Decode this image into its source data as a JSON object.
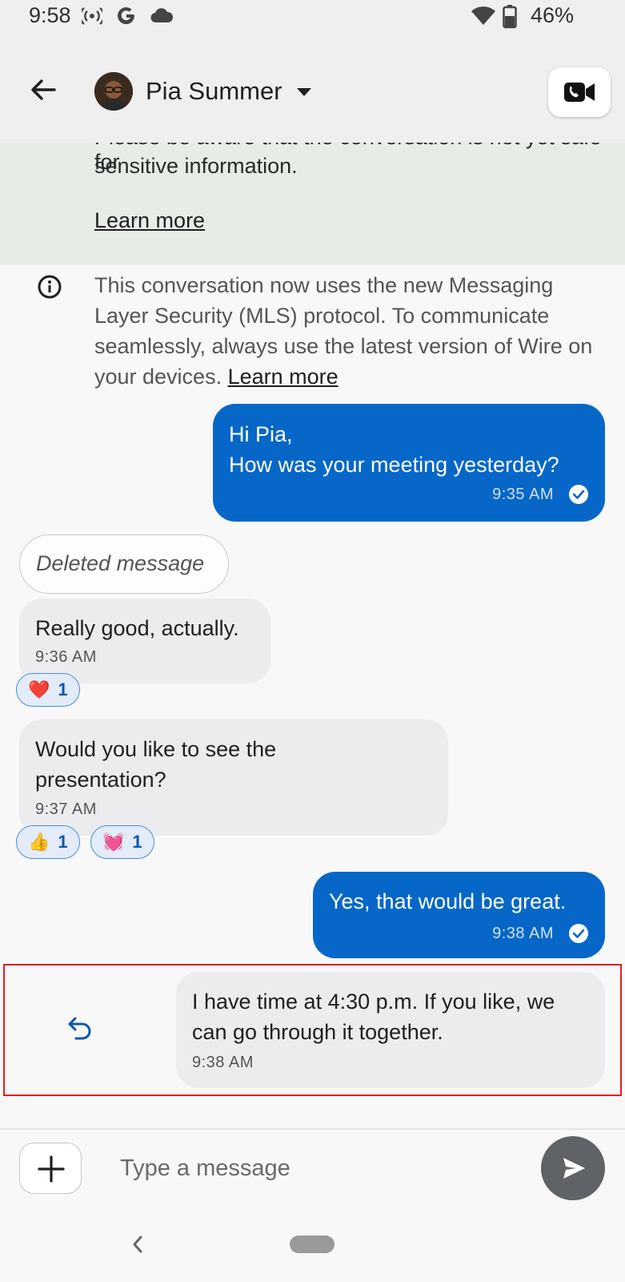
{
  "status_bar": {
    "time": "9:58",
    "battery": "46%",
    "icons": [
      "broadcast-icon",
      "google-icon",
      "cloud-icon",
      "wifi-icon",
      "battery-icon"
    ]
  },
  "header": {
    "contact_name": "Pia Summer",
    "icons": [
      "back-arrow-icon",
      "avatar",
      "caret-down-icon",
      "video-call-icon"
    ]
  },
  "notice": {
    "partial_line": "Please be aware that the conversation is not yet safe for",
    "text": "sensitive information.",
    "link": "Learn more"
  },
  "system_message": {
    "text": "This conversation now uses the new Messaging Layer Security (MLS) protocol. To communicate seamlessly, always use the latest version of Wire on your devices. ",
    "link": "Learn more"
  },
  "messages": [
    {
      "direction": "out",
      "text": "Hi Pia,\nHow was your meeting yesterday?",
      "time": "9:35 AM",
      "status": "delivered"
    },
    {
      "direction": "in",
      "deleted": true,
      "text": "Deleted message"
    },
    {
      "direction": "in",
      "text": "Really good, actually.",
      "time": "9:36 AM",
      "reactions": [
        {
          "emoji": "❤️",
          "count": "1"
        }
      ]
    },
    {
      "direction": "in",
      "text": "Would you like to see the\npresentation?",
      "time": "9:37 AM",
      "reactions": [
        {
          "emoji": "👍",
          "count": "1"
        },
        {
          "emoji": "💓",
          "count": "1"
        }
      ]
    },
    {
      "direction": "out",
      "text": "Yes, that would be great.",
      "time": "9:38 AM",
      "status": "delivered"
    },
    {
      "direction": "in",
      "text": "I have time at 4:30 p.m. If you like, we\ncan go through it together.",
      "time": "9:38 AM",
      "swipe_action": "reply"
    }
  ],
  "composer": {
    "placeholder": "Type a message",
    "value": ""
  },
  "colors": {
    "outgoing_bubble": "#0667c8",
    "incoming_bubble": "#ececee",
    "notice_bg": "#e5ede5",
    "highlight_border": "#e02020"
  }
}
